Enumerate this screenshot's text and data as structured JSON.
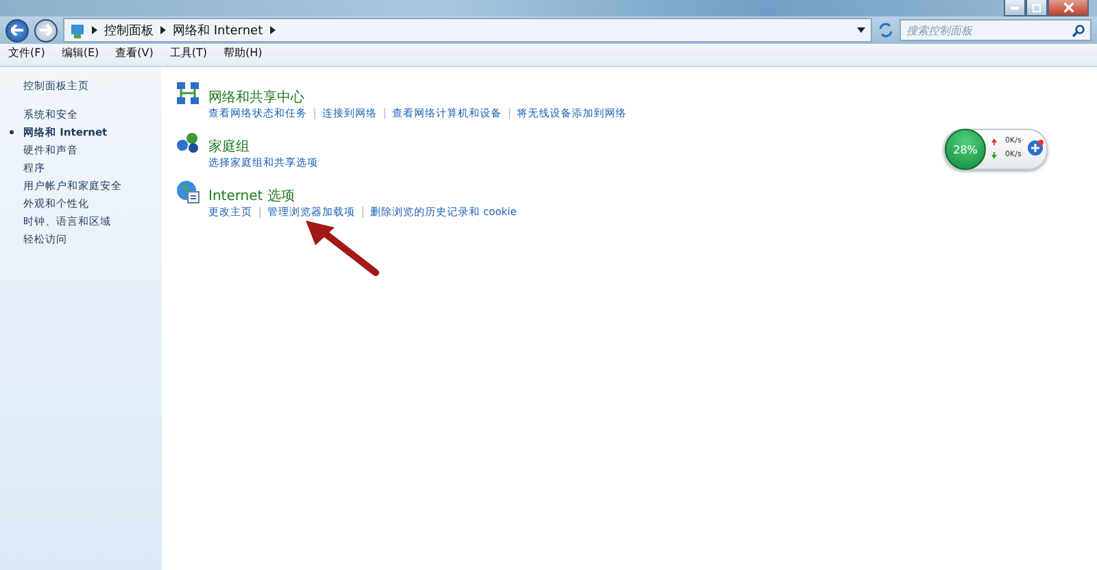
{
  "address_bar": {
    "breadcrumbs": [
      "控制面板",
      "网络和 Internet"
    ],
    "search_placeholder": "搜索控制面板"
  },
  "menu": [
    "文件(F)",
    "编辑(E)",
    "查看(V)",
    "工具(T)",
    "帮助(H)"
  ],
  "sidebar": {
    "home": "控制面板主页",
    "items": [
      {
        "label": "系统和安全",
        "selected": false
      },
      {
        "label": "网络和 Internet",
        "selected": true
      },
      {
        "label": "硬件和声音",
        "selected": false
      },
      {
        "label": "程序",
        "selected": false
      },
      {
        "label": "用户帐户和家庭安全",
        "selected": false
      },
      {
        "label": "外观和个性化",
        "selected": false
      },
      {
        "label": "时钟、语言和区域",
        "selected": false
      },
      {
        "label": "轻松访问",
        "selected": false
      }
    ]
  },
  "categories": [
    {
      "kind": "network",
      "title": "网络和共享中心",
      "links": [
        "查看网络状态和任务",
        "连接到网络",
        "查看网络计算机和设备",
        "将无线设备添加到网络"
      ]
    },
    {
      "kind": "homegroup",
      "title": "家庭组",
      "links": [
        "选择家庭组和共享选项"
      ]
    },
    {
      "kind": "internet",
      "title": "Internet 选项",
      "links": [
        "更改主页",
        "管理浏览器加载项",
        "删除浏览的历史记录和 cookie"
      ]
    }
  ],
  "speed_widget": {
    "percent": "28%",
    "upload": "0K/s",
    "download": "0K/s"
  }
}
